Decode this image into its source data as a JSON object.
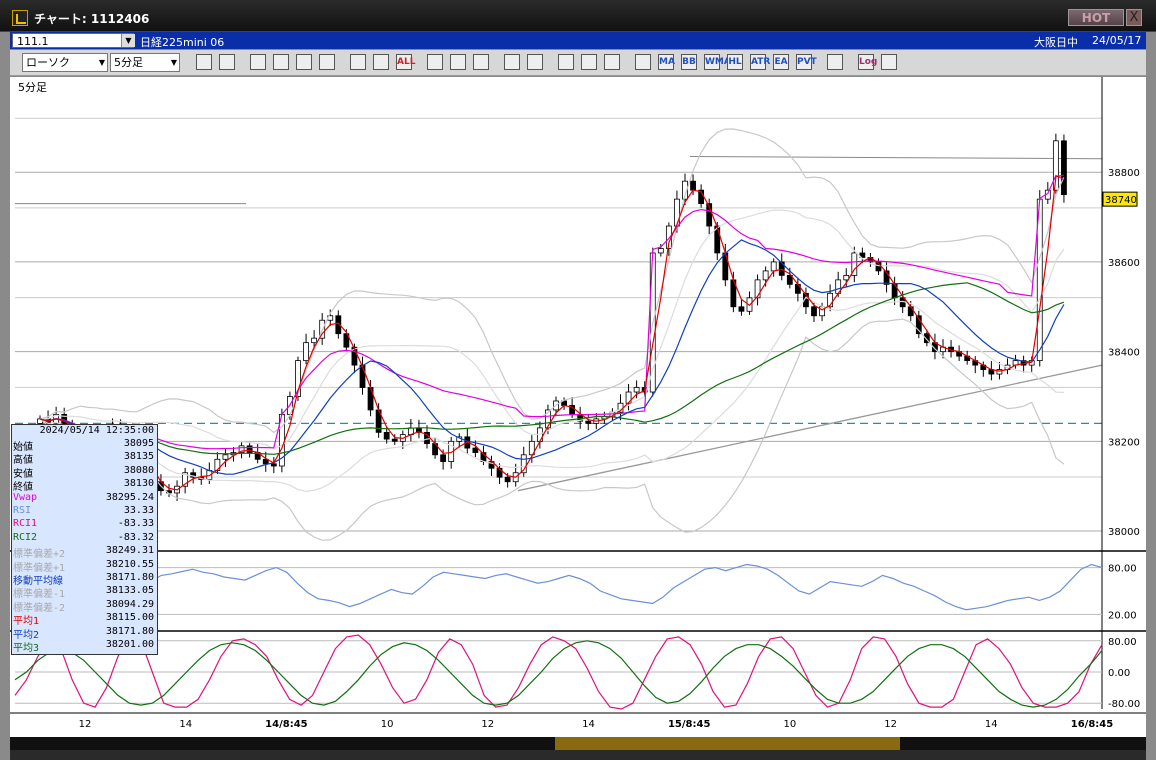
{
  "window": {
    "title": "チャート: 1112406",
    "hot_label": "HOT",
    "close_label": "X"
  },
  "infobar": {
    "code": "111.1",
    "instrument": "日経225mini 06",
    "market": "大阪日中",
    "date": "24/05/17"
  },
  "toolbar": {
    "chart_type": "ローソク",
    "period": "5分足",
    "icons": [
      "zoom-icon",
      "crosshair-icon",
      "download-icon",
      "search-chart-icon",
      "compare-icon",
      "lock-icon",
      "candle-icon",
      "candle-alt-icon",
      "all-icon",
      "pen-icon",
      "line-tool-icon",
      "pointer-icon",
      "document-icon",
      "trash-icon",
      "settings-icon",
      "tool-icon",
      "color-icon",
      "indicator-1-icon",
      "ma-icon",
      "bb-icon",
      "wma-icon",
      "hl-icon",
      "atr-icon",
      "ea-icon",
      "pvt-icon",
      "window-icon",
      "log-icon",
      "export-icon"
    ],
    "icon_labels": [
      "",
      "",
      "",
      "",
      "",
      "",
      "",
      "",
      "ALL",
      "",
      "",
      "",
      "",
      "",
      "",
      "",
      "",
      "",
      "MA",
      "BB",
      "WMA",
      "HL",
      "ATR",
      "EA",
      "PVT",
      "",
      "Log",
      ""
    ]
  },
  "panel_label": "5分足",
  "legend": {
    "datetime": "2024/05/14 12:35:00",
    "rows": [
      {
        "k": "始値",
        "v": "38095",
        "c": "#000"
      },
      {
        "k": "高値",
        "v": "38135",
        "c": "#000"
      },
      {
        "k": "安値",
        "v": "38080",
        "c": "#000"
      },
      {
        "k": "終値",
        "v": "38130",
        "c": "#000"
      },
      {
        "k": "Vwap",
        "v": "38295.24",
        "c": "#e000e0"
      },
      {
        "k": "RSI",
        "v": "33.33",
        "c": "#6a90d8"
      },
      {
        "k": "RCI1",
        "v": "-83.33",
        "c": "#e0107a"
      },
      {
        "k": "RCI2",
        "v": "-83.32",
        "c": "#107010"
      },
      {
        "k": "標準偏差+2",
        "v": "38249.31",
        "c": "#a8a8a8"
      },
      {
        "k": "標準偏差+1",
        "v": "38210.55",
        "c": "#a8a8a8"
      },
      {
        "k": "移動平均線",
        "v": "38171.80",
        "c": "#1040c0"
      },
      {
        "k": "標準偏差-1",
        "v": "38133.05",
        "c": "#a8a8a8"
      },
      {
        "k": "標準偏差-2",
        "v": "38094.29",
        "c": "#a8a8a8"
      },
      {
        "k": "平均1",
        "v": "38115.00",
        "c": "#e00000"
      },
      {
        "k": "平均2",
        "v": "38171.80",
        "c": "#1040c0"
      },
      {
        "k": "平均3",
        "v": "38201.00",
        "c": "#107010"
      }
    ]
  },
  "chart_data": [
    {
      "type": "candlestick",
      "title": "5分足",
      "price_axis": {
        "ticks": [
          38000,
          38200,
          38400,
          38600,
          38800
        ],
        "tick_labels": [
          "38000",
          "38200",
          "38400",
          "38600",
          "38800"
        ],
        "ylim": [
          37960,
          38990
        ]
      },
      "current_price": {
        "value": 38740,
        "label": "38740"
      },
      "x_axis": {
        "tick_labels": [
          "12",
          "14",
          "14/8:45",
          "10",
          "12",
          "14",
          "15/8:45",
          "10",
          "12",
          "14",
          "16/8:45"
        ],
        "bold": [
          false,
          false,
          true,
          false,
          false,
          false,
          true,
          false,
          false,
          false,
          true
        ]
      },
      "closes": [
        38250,
        38240,
        38260,
        38235,
        38210,
        38190,
        38200,
        38185,
        38190,
        38235,
        38215,
        38205,
        38180,
        38130,
        38110,
        38090,
        38085,
        38100,
        38130,
        38120,
        38115,
        38135,
        38160,
        38170,
        38175,
        38190,
        38175,
        38160,
        38150,
        38145,
        38260,
        38300,
        38380,
        38420,
        38430,
        38470,
        38480,
        38440,
        38410,
        38370,
        38320,
        38270,
        38220,
        38205,
        38200,
        38215,
        38230,
        38220,
        38195,
        38170,
        38155,
        38200,
        38210,
        38185,
        38175,
        38155,
        38140,
        38120,
        38110,
        38130,
        38170,
        38200,
        38230,
        38270,
        38290,
        38280,
        38260,
        38245,
        38240,
        38250,
        38255,
        38265,
        38285,
        38310,
        38320,
        38310,
        38620,
        38630,
        38680,
        38740,
        38780,
        38760,
        38730,
        38680,
        38620,
        38560,
        38500,
        38490,
        38520,
        38560,
        38580,
        38600,
        38570,
        38550,
        38530,
        38500,
        38480,
        38500,
        38530,
        38560,
        38570,
        38620,
        38610,
        38600,
        38580,
        38550,
        38520,
        38500,
        38480,
        38440,
        38420,
        38400,
        38410,
        38400,
        38390,
        38380,
        38370,
        38360,
        38350,
        38360,
        38370,
        38380,
        38370,
        38380,
        38740,
        38760,
        38870,
        38750
      ],
      "series": [
        {
          "name": "平均1",
          "color": "#e00000"
        },
        {
          "name": "平均2",
          "color": "#1040c0"
        },
        {
          "name": "平均3",
          "color": "#107010"
        },
        {
          "name": "Vwap",
          "color": "#e000e0"
        },
        {
          "name": "標準偏差",
          "color": "#a8a8a8"
        }
      ],
      "grid": true
    },
    {
      "type": "line",
      "title": "RSI",
      "ticks": [
        20,
        80
      ],
      "tick_labels": [
        "20.00",
        "80.00"
      ],
      "ylim": [
        0,
        100
      ],
      "series": [
        {
          "name": "RSI",
          "color": "#6a90d8",
          "values": [
            55,
            60,
            52,
            45,
            38,
            30,
            28,
            35,
            42,
            48,
            55,
            60,
            58,
            62,
            70,
            72,
            75,
            78,
            74,
            72,
            68,
            66,
            64,
            70,
            76,
            80,
            74,
            60,
            48,
            40,
            38,
            35,
            30,
            34,
            40,
            46,
            52,
            48,
            46,
            56,
            68,
            74,
            72,
            70,
            68,
            66,
            70,
            72,
            68,
            64,
            60,
            62,
            66,
            70,
            66,
            60,
            50,
            45,
            40,
            38,
            36,
            34,
            42,
            54,
            62,
            70,
            78,
            80,
            76,
            80,
            84,
            82,
            78,
            70,
            60,
            50,
            46,
            54,
            62,
            60,
            58,
            56,
            62,
            70,
            66,
            60,
            56,
            50,
            44,
            36,
            30,
            26,
            28,
            30,
            34,
            38,
            40,
            42,
            38,
            42,
            50,
            64,
            78,
            84,
            80
          ]
        }
      ]
    },
    {
      "type": "line",
      "title": "RCI",
      "ticks": [
        80,
        0,
        -80
      ],
      "tick_labels": [
        "80.00",
        "0.00",
        "-80.00"
      ],
      "ylim": [
        -100,
        100
      ],
      "series": [
        {
          "name": "RCI1",
          "color": "#e0107a",
          "values": [
            -60,
            -20,
            40,
            80,
            60,
            -20,
            -80,
            -90,
            -40,
            40,
            90,
            80,
            0,
            -80,
            -90,
            -90,
            -70,
            -20,
            40,
            80,
            85,
            70,
            40,
            -20,
            -70,
            -85,
            -60,
            0,
            60,
            90,
            95,
            70,
            20,
            -40,
            -80,
            -70,
            -20,
            50,
            85,
            70,
            20,
            -60,
            -90,
            -85,
            -40,
            20,
            70,
            90,
            80,
            60,
            10,
            -50,
            -90,
            -95,
            -80,
            -20,
            40,
            85,
            90,
            70,
            20,
            -50,
            -90,
            -85,
            -30,
            40,
            85,
            90,
            60,
            0,
            -60,
            -90,
            -80,
            -20,
            60,
            90,
            85,
            40,
            -30,
            -80,
            -90,
            -90,
            -70,
            0,
            70,
            85,
            60,
            20,
            -40,
            -80,
            -90,
            -90,
            -80,
            -50,
            20,
            70
          ]
        },
        {
          "name": "RCI2",
          "color": "#107010",
          "values": [
            -20,
            0,
            30,
            50,
            60,
            50,
            30,
            0,
            -30,
            -60,
            -80,
            -85,
            -80,
            -60,
            -30,
            0,
            30,
            55,
            70,
            75,
            70,
            55,
            30,
            0,
            -30,
            -60,
            -80,
            -85,
            -75,
            -50,
            -20,
            15,
            45,
            65,
            75,
            70,
            55,
            30,
            0,
            -30,
            -60,
            -80,
            -85,
            -80,
            -60,
            -30,
            0,
            35,
            60,
            75,
            80,
            75,
            60,
            35,
            0,
            -35,
            -65,
            -80,
            -75,
            -55,
            -25,
            10,
            40,
            60,
            70,
            70,
            60,
            40,
            15,
            -15,
            -45,
            -70,
            -80,
            -80,
            -70,
            -50,
            -20,
            10,
            40,
            60,
            70,
            70,
            60,
            40,
            10,
            -20,
            -50,
            -70,
            -85,
            -90,
            -85,
            -70,
            -45,
            -10,
            20,
            55
          ]
        }
      ]
    }
  ]
}
